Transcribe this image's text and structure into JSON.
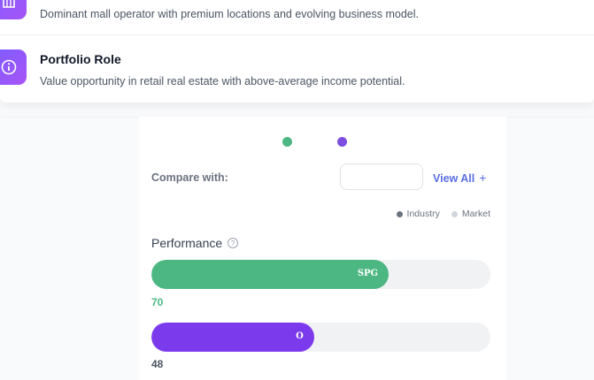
{
  "rows": [
    {
      "title": "",
      "description": "Dominant mall operator with premium locations and evolving business model."
    },
    {
      "title": "Portfolio Role",
      "description": "Value opportunity in retail real estate with above-average income potential."
    }
  ],
  "compare": {
    "label": "Compare with:",
    "input_value": "",
    "view_all": "View All"
  },
  "legend": [
    {
      "label": "Industry",
      "color": "#6b7280"
    },
    {
      "label": "Market",
      "color": "#d1d5db"
    }
  ],
  "performance": {
    "title": "Performance",
    "bars": [
      {
        "label": "SPG",
        "score": "70",
        "value": 70,
        "color": "#4cb782",
        "score_color": "#4cb782"
      },
      {
        "label": "O",
        "score": "48",
        "value": 48,
        "color": "#7c3aed",
        "score_color": "#4b5563"
      }
    ]
  },
  "colors": {
    "accent": "#7c5cff",
    "link": "#5b6ee1",
    "dot_a": "#4cb782",
    "dot_b": "#7c4ddf"
  }
}
